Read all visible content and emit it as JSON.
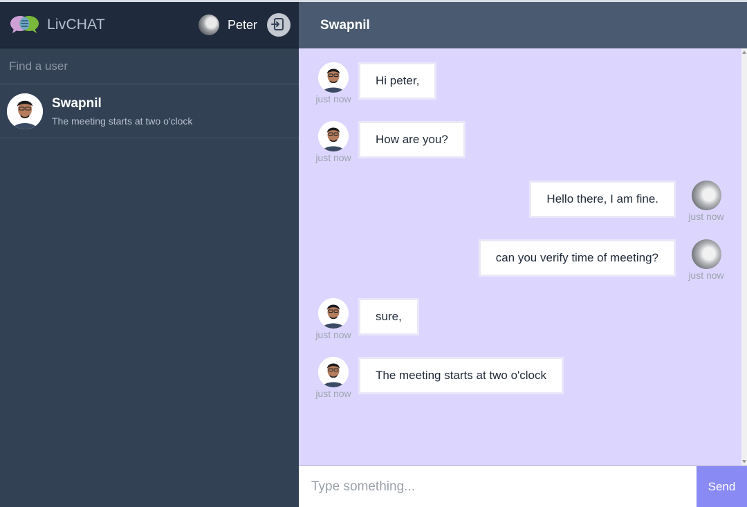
{
  "app": {
    "brand": "LivCHAT"
  },
  "current_user": {
    "name": "Peter"
  },
  "search": {
    "placeholder": "Find a user"
  },
  "contacts": [
    {
      "name": "Swapnil",
      "last_message": "The meeting starts at two o'clock"
    }
  ],
  "chat": {
    "title": "Swapnil",
    "messages": [
      {
        "side": "left",
        "text": "Hi peter,",
        "time": "just now"
      },
      {
        "side": "left",
        "text": "How are you?",
        "time": "just now"
      },
      {
        "side": "right",
        "text": "Hello there, I am fine.",
        "time": "just now"
      },
      {
        "side": "right",
        "text": "can you verify time of meeting?",
        "time": "just now"
      },
      {
        "side": "left",
        "text": "sure,",
        "time": "just now"
      },
      {
        "side": "left",
        "text": "The meeting starts at two o'clock",
        "time": "just now"
      }
    ]
  },
  "composer": {
    "placeholder": "Type something...",
    "send_label": "Send"
  },
  "icons": {
    "logo": "chat-bubbles-logo-icon",
    "logout": "logout-icon"
  },
  "colors": {
    "sidebar": "#334155",
    "sidebar_header": "#1f2a3c",
    "chat_header": "#4a5a70",
    "messages_bg": "#dcd6ff",
    "send_button": "#8a8af5"
  }
}
